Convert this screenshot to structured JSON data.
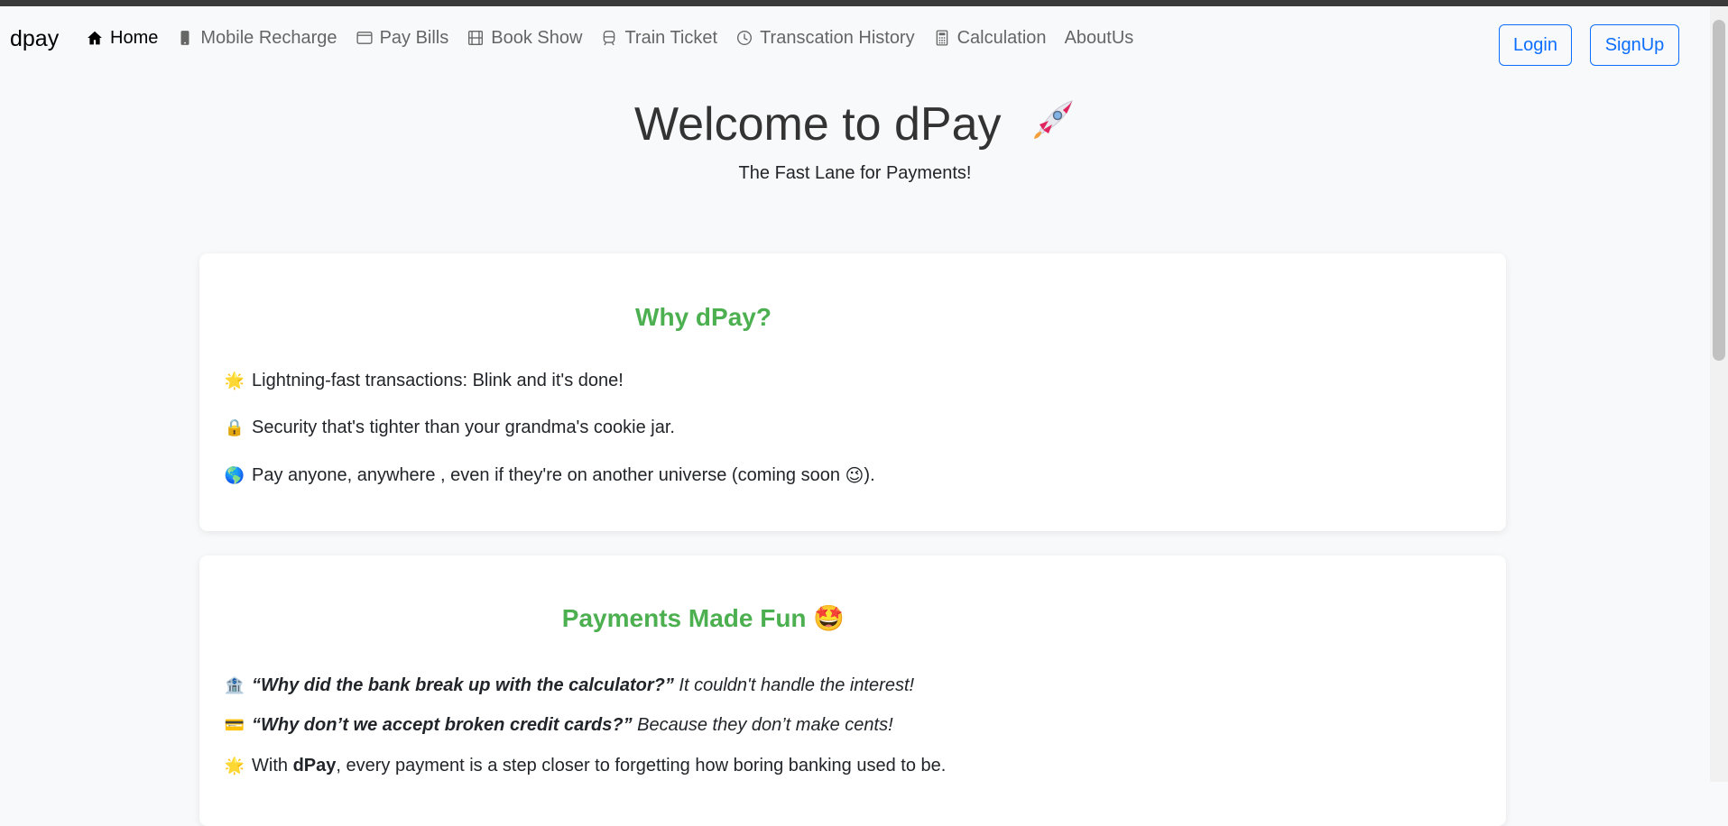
{
  "nav": {
    "brand": "dpay",
    "links": [
      {
        "label": "Home",
        "icon": "house-icon",
        "active": true
      },
      {
        "label": "Mobile Recharge",
        "icon": "phone-icon"
      },
      {
        "label": "Pay Bills",
        "icon": "window-icon"
      },
      {
        "label": "Book Show",
        "icon": "film-icon"
      },
      {
        "label": "Train Ticket",
        "icon": "train-icon"
      },
      {
        "label": "Transcation History",
        "icon": "clock-icon"
      },
      {
        "label": "Calculation",
        "icon": "calculator-icon"
      },
      {
        "label": "AboutUs"
      }
    ],
    "login_label": "Login",
    "signup_label": "SignUp"
  },
  "hero": {
    "title": "Welcome to dPay",
    "emoji": "🚀",
    "subtitle": "The Fast Lane for Payments!"
  },
  "why": {
    "title": "Why dPay?",
    "items": [
      {
        "emoji": "🌟",
        "text": "Lightning-fast transactions: Blink and it's done!"
      },
      {
        "emoji": "🔒",
        "text": "Security that's tighter than your grandma's cookie jar."
      },
      {
        "emoji": "🌎",
        "text_before": "Pay anyone, anywhere , even if they're on another universe (coming soon ",
        "wink": "😉",
        "text_after": ")."
      }
    ]
  },
  "fun": {
    "title": "Payments Made Fun",
    "title_emoji": "🤩",
    "jokes": [
      {
        "emoji": "🏦",
        "question": "“Why did the bank break up with the calculator?”",
        "answer": "It couldn't handle the interest!"
      },
      {
        "emoji": "💳",
        "question": "“Why don’t we accept broken credit cards?”",
        "answer": "Because they don’t make cents!"
      }
    ],
    "closing": {
      "emoji": "🌟",
      "before": "With",
      "bold": "dPay",
      "after": ", every payment is a step closer to forgetting how boring banking used to be."
    }
  },
  "colors": {
    "accent": "#0d6efd",
    "heading_green": "#4caf50",
    "background": "#f8f9fa"
  }
}
